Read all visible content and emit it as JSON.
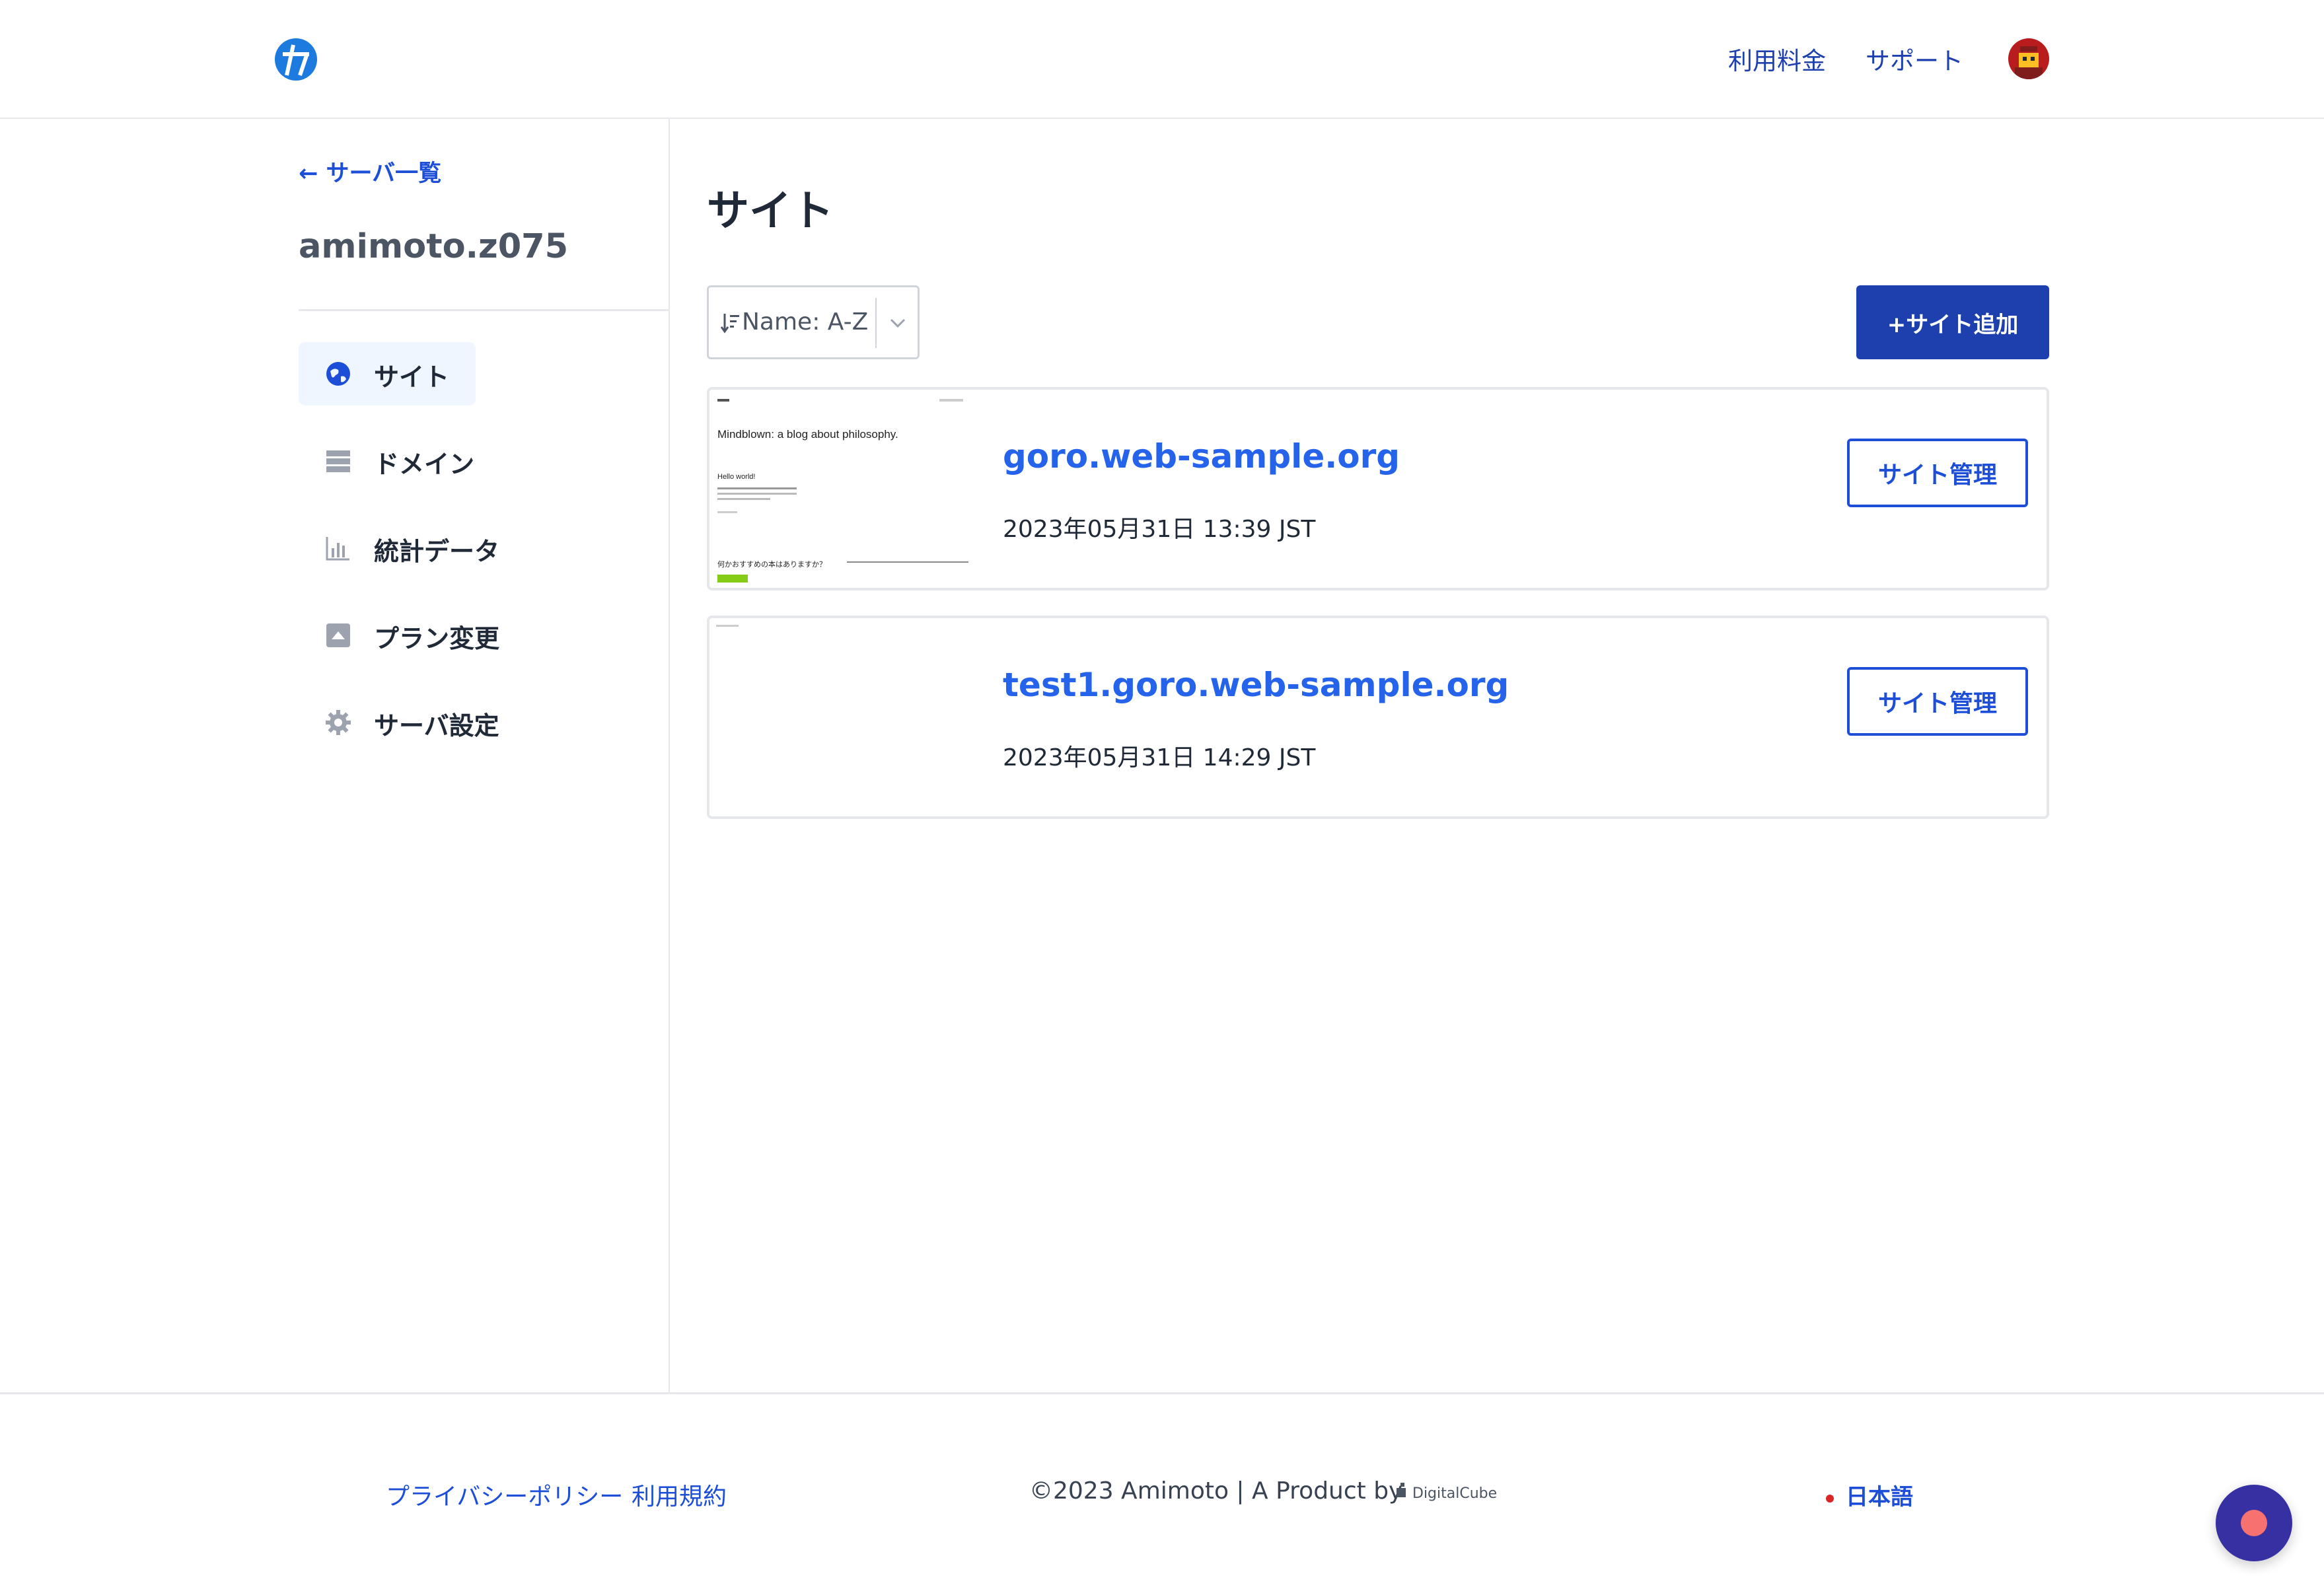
{
  "header": {
    "links": [
      "利用料金",
      "サポート"
    ]
  },
  "sidebar": {
    "back_label": "← サーバ一覧",
    "server_name": "amimoto.z075",
    "items": [
      {
        "label": "サイト",
        "icon": "globe-icon",
        "active": true
      },
      {
        "label": "ドメイン",
        "icon": "server-icon",
        "active": false
      },
      {
        "label": "統計データ",
        "icon": "bar-chart-icon",
        "active": false
      },
      {
        "label": "プラン変更",
        "icon": "upgrade-icon",
        "active": false
      },
      {
        "label": "サーバ設定",
        "icon": "gear-icon",
        "active": false
      }
    ]
  },
  "main": {
    "title": "サイト",
    "sort": {
      "label": "Name: A-Z"
    },
    "add_button": "+サイト追加",
    "sites": [
      {
        "name": "goro.web-sample.org",
        "date": "2023年05月31日 13:39 JST",
        "manage_label": "サイト管理",
        "thumbnail": {
          "headline": "Mindblown: a blog about philosophy.",
          "post_title": "Hello world!",
          "question": "何かおすすめの本はありますか？"
        }
      },
      {
        "name": "test1.goro.web-sample.org",
        "date": "2023年05月31日 14:29 JST",
        "manage_label": "サイト管理"
      }
    ]
  },
  "footer": {
    "privacy": "プライバシーポリシー",
    "terms": "利用規約",
    "copyright": "©2023 Amimoto | A Product by",
    "company": "DigitalCube",
    "language": "日本語"
  },
  "colors": {
    "primary": "#1e40af",
    "link": "#2563eb",
    "active_bg": "#eff6ff",
    "chat_bubble": "#3730a3",
    "chat_dot": "#f87171"
  }
}
